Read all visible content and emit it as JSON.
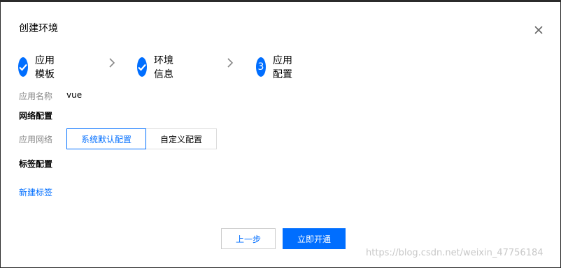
{
  "dialog": {
    "title": "创建环境"
  },
  "steps": [
    {
      "label": "应用模板",
      "state": "done"
    },
    {
      "label": "环境信息",
      "state": "done"
    },
    {
      "number": "3",
      "label": "应用配置",
      "state": "active"
    }
  ],
  "form": {
    "app_name_label": "应用名称",
    "app_name_value": "vue",
    "network_section": "网络配置",
    "network_label": "应用网络",
    "network_options": [
      "系统默认配置",
      "自定义配置"
    ],
    "tag_section": "标签配置",
    "new_tag_link": "新建标签"
  },
  "footer": {
    "prev_label": "上一步",
    "submit_label": "立即开通"
  },
  "watermark": "https://blog.csdn.net/weixin_47756184",
  "colors": {
    "accent": "#006eff"
  }
}
